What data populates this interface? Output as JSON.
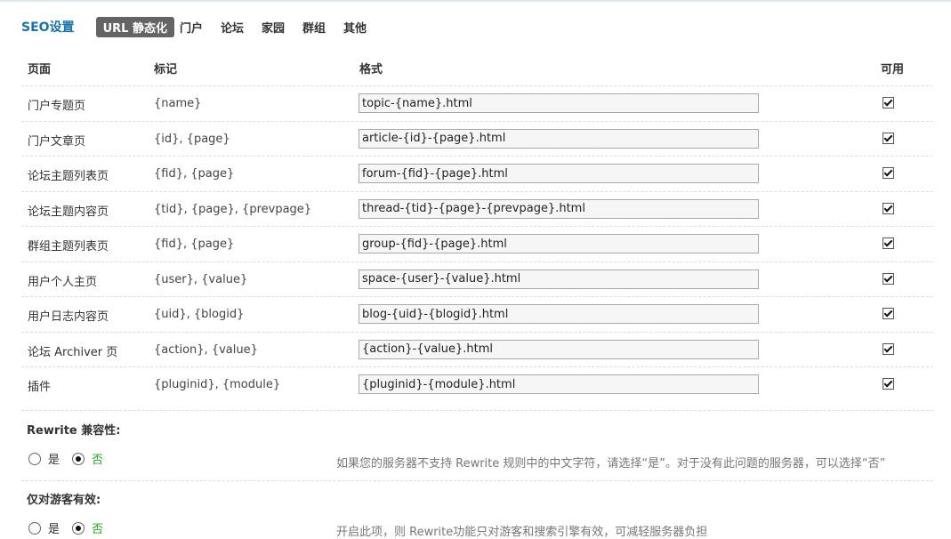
{
  "header": {
    "title": "SEO设置",
    "tabs": [
      "URL 静态化",
      "门户",
      "论坛",
      "家园",
      "群组",
      "其他"
    ]
  },
  "table": {
    "headers": {
      "page": "页面",
      "mark": "标记",
      "format": "格式",
      "enabled": "可用"
    },
    "rows": [
      {
        "page": "门户专题页",
        "mark": "{name}",
        "format": "topic-{name}.html",
        "enabled": true
      },
      {
        "page": "门户文章页",
        "mark": "{id}, {page}",
        "format": "article-{id}-{page}.html",
        "enabled": true
      },
      {
        "page": "论坛主题列表页",
        "mark": "{fid}, {page}",
        "format": "forum-{fid}-{page}.html",
        "enabled": true
      },
      {
        "page": "论坛主题内容页",
        "mark": "{tid}, {page}, {prevpage}",
        "format": "thread-{tid}-{page}-{prevpage}.html",
        "enabled": true
      },
      {
        "page": "群组主题列表页",
        "mark": "{fid}, {page}",
        "format": "group-{fid}-{page}.html",
        "enabled": true
      },
      {
        "page": "用户个人主页",
        "mark": "{user}, {value}",
        "format": "space-{user}-{value}.html",
        "enabled": true
      },
      {
        "page": "用户日志内容页",
        "mark": "{uid}, {blogid}",
        "format": "blog-{uid}-{blogid}.html",
        "enabled": true
      },
      {
        "page": "论坛 Archiver 页",
        "mark": "{action}, {value}",
        "format": "{action}-{value}.html",
        "enabled": true
      },
      {
        "page": "插件",
        "mark": "{pluginid}, {module}",
        "format": "{pluginid}-{module}.html",
        "enabled": true
      }
    ]
  },
  "rewrite_compat": {
    "title": "Rewrite 兼容性:",
    "yes": "是",
    "no": "否",
    "selected": "no",
    "tip": "如果您的服务器不支持 Rewrite 规则中的中文字符，请选择“是”。对于没有此问题的服务器，可以选择“否”"
  },
  "guest_only": {
    "title": "仅对游客有效:",
    "yes": "是",
    "no": "否",
    "selected": "no",
    "tip": "开启此项，则 Rewrite功能只对游客和搜索引擎有效，可减轻服务器负担"
  }
}
